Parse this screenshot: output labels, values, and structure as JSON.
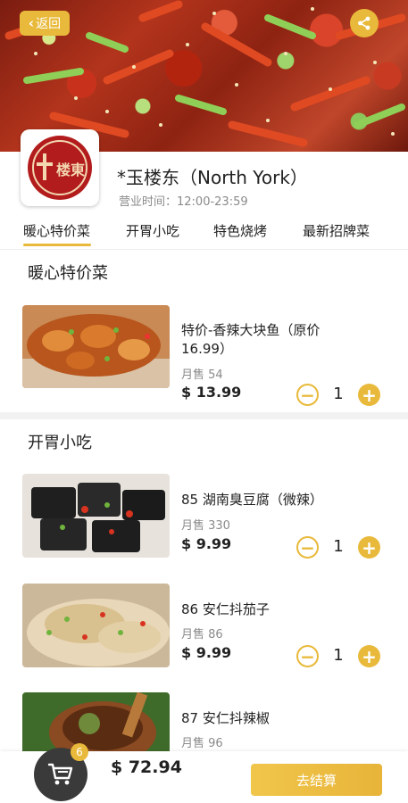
{
  "header": {
    "back_label": "返回",
    "store_name": "*玉楼东（North York）",
    "hours": "营业时间：12:00-23:59",
    "logo_text": "楼東"
  },
  "tabs": [
    {
      "label": "暖心特价菜",
      "active": true
    },
    {
      "label": "开胃小吃",
      "active": false
    },
    {
      "label": "特色烧烤",
      "active": false
    },
    {
      "label": "最新招牌菜",
      "active": false
    }
  ],
  "sections": [
    {
      "title": "暖心特价菜",
      "items": [
        {
          "name": "特价-香辣大块鱼（原价16.99）",
          "sales": "月售 54",
          "price": "$ 13.99",
          "qty": "1"
        }
      ]
    },
    {
      "title": "开胃小吃",
      "items": [
        {
          "name": "85 湖南臭豆腐（微辣）",
          "sales": "月售 330",
          "price": "$ 9.99",
          "qty": "1"
        },
        {
          "name": "86 安仁抖茄子",
          "sales": "月售 86",
          "price": "$ 9.99",
          "qty": "1"
        },
        {
          "name": "87 安仁抖辣椒",
          "sales": "月售 96"
        }
      ]
    }
  ],
  "cart": {
    "badge": "6",
    "total": "$ 72.94",
    "checkout_label": "去结算"
  },
  "controls": {
    "minus": "−",
    "plus": "+"
  },
  "colors": {
    "accent": "#e8b93a",
    "cart_dark": "#3a3a3a"
  }
}
